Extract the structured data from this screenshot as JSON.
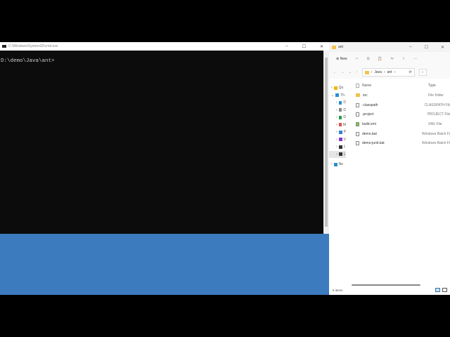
{
  "cmd": {
    "title": "C:\\Windows\\System32\\cmd.exe",
    "prompt": "D:\\demo\\Java\\ant>",
    "controls": [
      "–",
      "☐",
      "✕"
    ]
  },
  "explorer": {
    "title": "ant",
    "controls": [
      "–",
      "☐",
      "✕"
    ],
    "toolbar": {
      "new_label": "New",
      "icons": [
        "✂",
        "⧉",
        "📋",
        "⇆",
        "⇪",
        "···"
      ]
    },
    "nav_buttons": [
      "←",
      "→",
      "⌄",
      "↑"
    ],
    "breadcrumb": [
      "Java",
      "ant"
    ],
    "nav_pane": [
      {
        "label": "Qu",
        "color": "#f3b700"
      },
      {
        "label": "Th",
        "color": "#2a8fd0"
      },
      {
        "label": "D",
        "color": "#2a8fd0"
      },
      {
        "label": "D",
        "color": "#888"
      },
      {
        "label": "D",
        "color": "#2a9a4a"
      },
      {
        "label": "M",
        "color": "#e0504a"
      },
      {
        "label": "P",
        "color": "#3a7fd0"
      },
      {
        "label": "V",
        "color": "#8a3ad0"
      },
      {
        "label": "L",
        "color": "#333"
      },
      {
        "label": "L",
        "color": "#333"
      },
      {
        "label": "Ne",
        "color": "#2a8fd0"
      }
    ],
    "columns": {
      "name": "Name",
      "type": "Type"
    },
    "files": [
      {
        "name": "src",
        "type": "File folder",
        "kind": "folder"
      },
      {
        "name": ".classpath",
        "type": "CLASSPATH File",
        "kind": "file"
      },
      {
        "name": ".project",
        "type": "PROJECT File",
        "kind": "file"
      },
      {
        "name": "build.xml",
        "type": "XML File",
        "kind": "xml"
      },
      {
        "name": "demo.bat",
        "type": "Windows Batch File",
        "kind": "bat"
      },
      {
        "name": "demo-junit.bat",
        "type": "Windows Batch File",
        "kind": "bat"
      }
    ],
    "status": "6 items"
  }
}
